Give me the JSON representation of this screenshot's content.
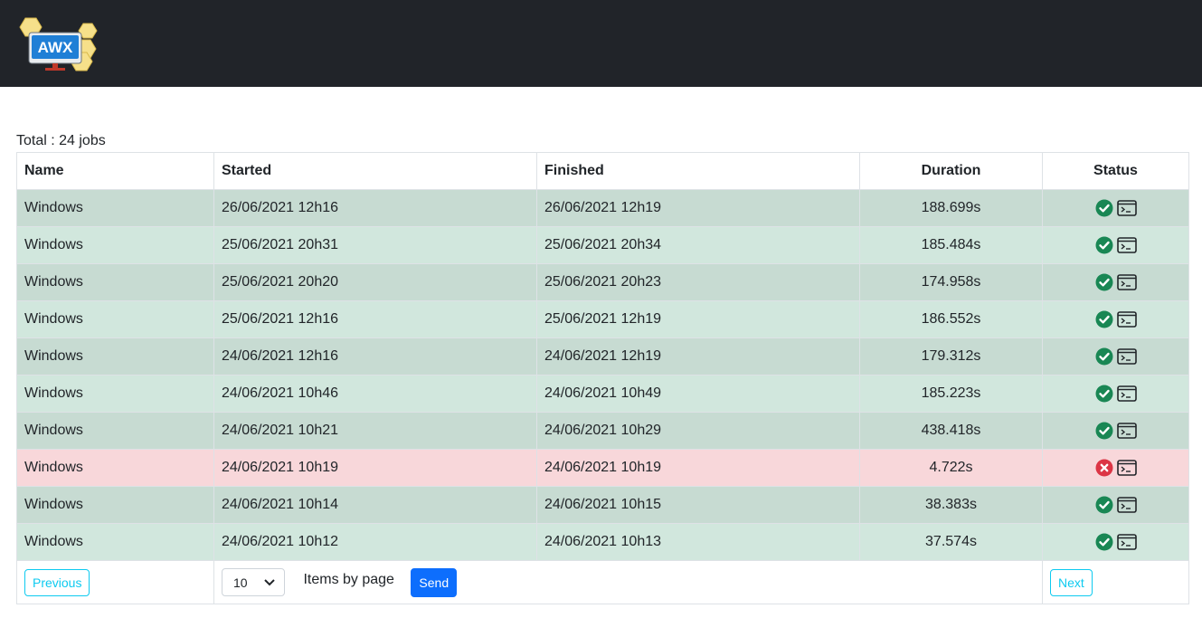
{
  "app": {
    "logo_text": "AWX"
  },
  "summary": {
    "total": "Total : 24 jobs"
  },
  "table": {
    "columns": [
      "Name",
      "Started",
      "Finished",
      "Duration",
      "Status"
    ],
    "rows": [
      {
        "name": "Windows",
        "started": "26/06/2021 12h16",
        "finished": "26/06/2021 12h19",
        "duration": "188.699s",
        "status": "successful"
      },
      {
        "name": "Windows",
        "started": "25/06/2021 20h31",
        "finished": "25/06/2021 20h34",
        "duration": "185.484s",
        "status": "successful"
      },
      {
        "name": "Windows",
        "started": "25/06/2021 20h20",
        "finished": "25/06/2021 20h23",
        "duration": "174.958s",
        "status": "successful"
      },
      {
        "name": "Windows",
        "started": "25/06/2021 12h16",
        "finished": "25/06/2021 12h19",
        "duration": "186.552s",
        "status": "successful"
      },
      {
        "name": "Windows",
        "started": "24/06/2021 12h16",
        "finished": "24/06/2021 12h19",
        "duration": "179.312s",
        "status": "successful"
      },
      {
        "name": "Windows",
        "started": "24/06/2021 10h46",
        "finished": "24/06/2021 10h49",
        "duration": "185.223s",
        "status": "successful"
      },
      {
        "name": "Windows",
        "started": "24/06/2021 10h21",
        "finished": "24/06/2021 10h29",
        "duration": "438.418s",
        "status": "successful"
      },
      {
        "name": "Windows",
        "started": "24/06/2021 10h19",
        "finished": "24/06/2021 10h19",
        "duration": "4.722s",
        "status": "failed"
      },
      {
        "name": "Windows",
        "started": "24/06/2021 10h14",
        "finished": "24/06/2021 10h15",
        "duration": "38.383s",
        "status": "successful"
      },
      {
        "name": "Windows",
        "started": "24/06/2021 10h12",
        "finished": "24/06/2021 10h13",
        "duration": "37.574s",
        "status": "successful"
      }
    ]
  },
  "pagination": {
    "previous_label": "Previous",
    "next_label": "Next",
    "page_size": "10",
    "items_by_page_label": "Items by page",
    "send_label": "Send"
  },
  "icons": {
    "success": "check-circle-icon",
    "failure": "x-circle-icon",
    "terminal": "terminal-icon"
  },
  "colors": {
    "topbar": "#212429",
    "success_row_dark": "#c7dbd2",
    "success_row_light": "#d1e7dd",
    "failed_row": "#f8d7da",
    "success_icon": "#198754",
    "failure_icon": "#dc3545",
    "outline_button": "#0dcaf0",
    "primary_button": "#0d6efd"
  }
}
